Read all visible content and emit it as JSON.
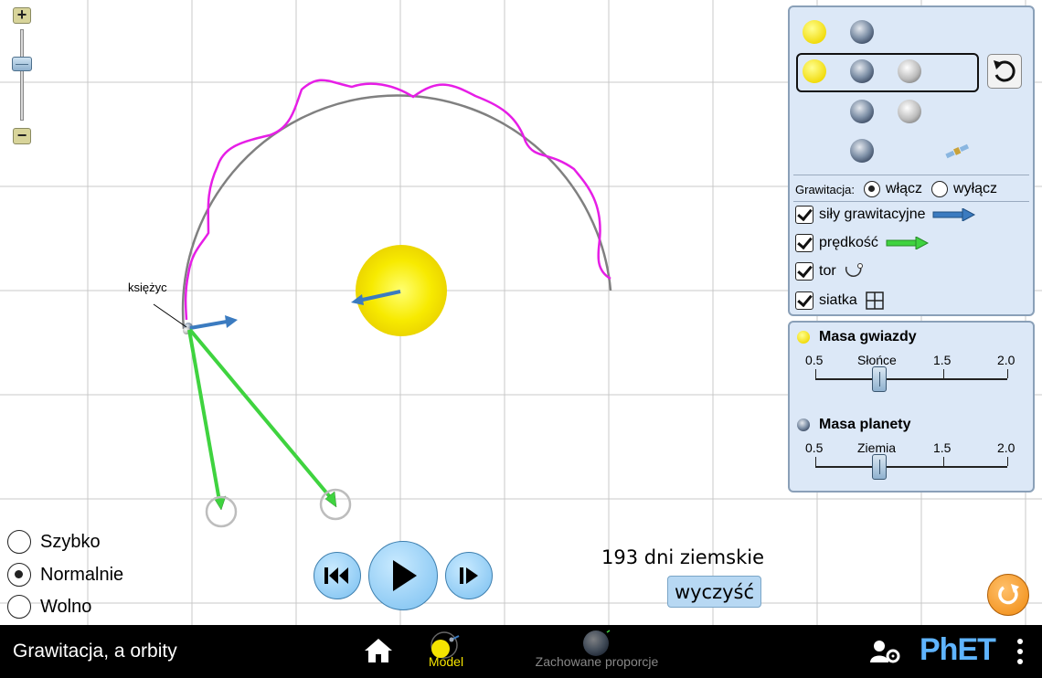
{
  "sim": {
    "body_label": "księżyc",
    "elapsed_time": "193 dni ziemskie",
    "clear_label": "wyczyść"
  },
  "controls": {
    "gravity_label": "Grawitacja:",
    "gravity_on": "włącz",
    "gravity_off": "wyłącz",
    "gravity_selected": "włącz",
    "checkboxes": [
      {
        "label": "siły grawitacyjne",
        "checked": true,
        "icon": "blue-arrow-icon"
      },
      {
        "label": "prędkość",
        "checked": true,
        "icon": "green-arrow-icon"
      },
      {
        "label": "tor",
        "checked": true,
        "icon": "path-icon"
      },
      {
        "label": "siatka",
        "checked": true,
        "icon": "grid-icon"
      }
    ]
  },
  "masses": {
    "star": {
      "title": "Masa gwiazdy",
      "ticks": [
        "0.5",
        "Słońce",
        "1.5",
        "2.0"
      ],
      "value": 1.0
    },
    "planet": {
      "title": "Masa planety",
      "ticks": [
        "0.5",
        "Ziemia",
        "1.5",
        "2.0"
      ],
      "value": 1.0
    }
  },
  "speed": {
    "options": [
      "Szybko",
      "Normalnie",
      "Wolno"
    ],
    "selected": "Normalnie"
  },
  "navbar": {
    "title": "Grawitacja, a orbity",
    "tabs": [
      {
        "label": "Model",
        "active": true
      },
      {
        "label": "Zachowane proporcje",
        "active": false
      }
    ],
    "logo": "PhET"
  },
  "colors": {
    "path": "#e61ee6",
    "force_arrow": "#3b7bc0",
    "velocity_arrow": "#3fd33f",
    "star": "#f5e400",
    "panel_bg": "#dce8f7",
    "active_tab": "#f5e400"
  }
}
